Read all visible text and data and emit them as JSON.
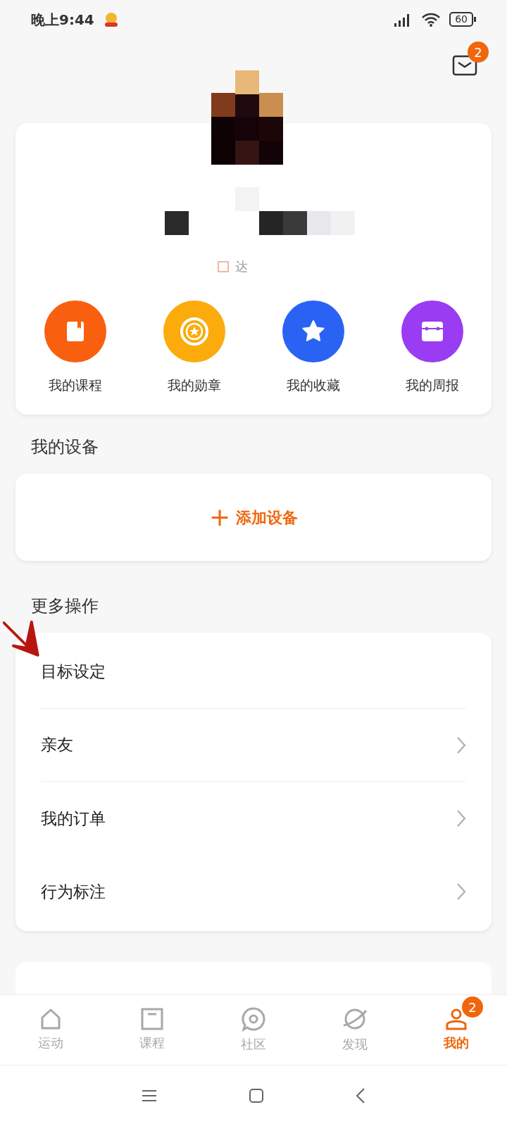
{
  "status_bar": {
    "time": "晚上9:44",
    "battery": "60"
  },
  "messages": {
    "badge": "2"
  },
  "profile": {
    "tag": "达",
    "shortcuts": [
      {
        "label": "我的课程",
        "color": "#f86010"
      },
      {
        "label": "我的勋章",
        "color": "#fbab0c"
      },
      {
        "label": "我的收藏",
        "color": "#2a63f4"
      },
      {
        "label": "我的周报",
        "color": "#9a3cf2"
      }
    ]
  },
  "devices": {
    "title": "我的设备",
    "add": {
      "icon": "+",
      "label": "添加设备"
    }
  },
  "more": {
    "title": "更多操作",
    "items": [
      {
        "label": "目标设定",
        "chevron": false
      },
      {
        "label": "亲友",
        "chevron": true
      },
      {
        "label": "我的订单",
        "chevron": true
      },
      {
        "label": "行为标注",
        "chevron": true
      }
    ]
  },
  "tabs": [
    {
      "label": "运动",
      "selected": false
    },
    {
      "label": "课程",
      "selected": false
    },
    {
      "label": "社区",
      "selected": false
    },
    {
      "label": "发现",
      "selected": false
    },
    {
      "label": "我的",
      "selected": true,
      "badge": "2"
    }
  ]
}
